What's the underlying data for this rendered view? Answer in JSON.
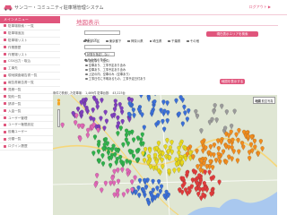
{
  "header": {
    "app_title": "サンコー・コミュニティ駐車場管理システム",
    "logout_label": "ログアウト ▶"
  },
  "sidebar": {
    "header_label": "メインメニュー",
    "items": [
      {
        "label": "駐車場検索・一覧"
      },
      {
        "label": "駐車場追加"
      },
      {
        "label": "駐車場リスト"
      },
      {
        "label": "作業履歴"
      },
      {
        "label": "作業場リスト"
      },
      {
        "label": "CSV出力・取込"
      },
      {
        "label": "工事先"
      },
      {
        "label": "現地調査報告書一覧"
      },
      {
        "label": "報告書報告書一覧"
      },
      {
        "label": "見積一覧"
      },
      {
        "label": "契約一覧"
      },
      {
        "label": "請求一覧"
      },
      {
        "label": "入金一覧"
      },
      {
        "label": "ユーザー管理"
      },
      {
        "label": "ユーザー権限設定"
      },
      {
        "label": "役職ユーザー"
      },
      {
        "label": "分類一覧"
      },
      {
        "label": "ログイン履歴"
      }
    ]
  },
  "main": {
    "page_title": "地図表示",
    "form": {
      "parking_name_label": "●駐車場名",
      "parking_name_value": "",
      "area_label": "●エリア",
      "area_options": [
        {
          "label": "東京23区"
        },
        {
          "label": "東京都下"
        },
        {
          "label": "神奈川県"
        },
        {
          "label": "埼玉県"
        },
        {
          "label": "千葉県"
        },
        {
          "label": "その他"
        }
      ],
      "owner_label": "●駐車場所",
      "owner_value": "",
      "status_label": "●状態",
      "status_value": "状態を指定しない",
      "other_label": "●その他の条件",
      "radio_options": [
        {
          "label": "指定なし（全件）",
          "checked": true
        },
        {
          "label": "空車あり、工事予定あり含み",
          "checked": false
        },
        {
          "label": "空車あり、工事予定あり含み",
          "checked": false
        },
        {
          "label": "上記の内、空車のみ（空車あり）",
          "checked": false
        },
        {
          "label": "工事日付に不明あるもの、工事予定日付あり",
          "checked": false
        }
      ],
      "current_area_button": "現在表示エリアを検索",
      "search_button": "地図を表示する"
    },
    "summary": "条件で検索した駐車場： 1,469件 駐車台数： 43,223台",
    "map": {
      "type_options": [
        "地図",
        "航空写真"
      ],
      "selected_type": "地図"
    }
  },
  "colors": {
    "accent": "#e0557c",
    "pin_colors": [
      "#7f3fbf",
      "#2fb24b",
      "#e8d81c",
      "#f28c1c",
      "#e23b3b",
      "#3a6fd8",
      "#e067b6",
      "#9b9b9b"
    ]
  }
}
